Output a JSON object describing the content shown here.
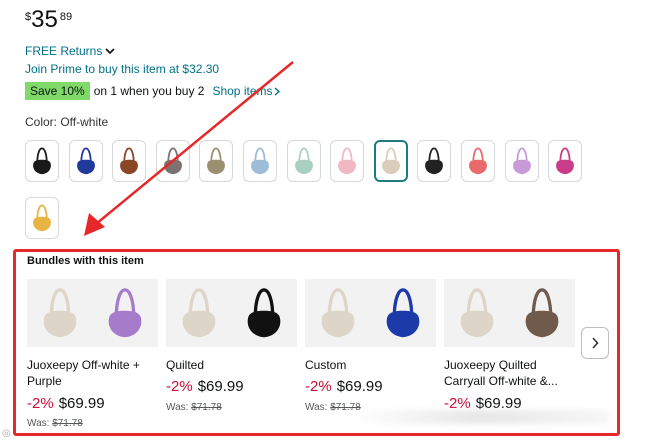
{
  "price": {
    "symbol": "$",
    "whole": "35",
    "fraction": "89"
  },
  "returns": {
    "label": "FREE Returns"
  },
  "prime": {
    "text": "Join Prime to buy this item at $32.30"
  },
  "promo": {
    "badge": "Save 10%",
    "text": "on 1 when you buy 2",
    "link": "Shop items"
  },
  "color": {
    "label": "Color: Off-white"
  },
  "swatches": [
    {
      "name": "Black",
      "color": "#1a1a1a"
    },
    {
      "name": "Blue",
      "color": "#1f3a9c"
    },
    {
      "name": "Brown",
      "color": "#8a4726"
    },
    {
      "name": "Grey",
      "color": "#7b7372"
    },
    {
      "name": "Khaki",
      "color": "#9c9072"
    },
    {
      "name": "Light Blue",
      "color": "#9fbcd6"
    },
    {
      "name": "Mint",
      "color": "#a9d0c1"
    },
    {
      "name": "Pink",
      "color": "#efb8c3"
    },
    {
      "name": "Off-white",
      "color": "#d9cdbb",
      "selected": true
    },
    {
      "name": "Black Quilted",
      "color": "#222222"
    },
    {
      "name": "Coral",
      "color": "#e86a6a"
    },
    {
      "name": "Lilac",
      "color": "#c79ad8"
    },
    {
      "name": "Magenta",
      "color": "#c83c8a"
    },
    {
      "name": "Yellow",
      "color": "#e8b442"
    }
  ],
  "bundles": {
    "title": "Bundles with this item",
    "items": [
      {
        "name_line1": "Juoxeepy Off-white +",
        "name_line2": "Purple",
        "discount": "-2%",
        "price": "$69.99",
        "was_label": "Was:",
        "was_price": "$71.78",
        "second_color": "#a67bc9"
      },
      {
        "name_line1": "Quilted",
        "name_line2": "",
        "discount": "-2%",
        "price": "$69.99",
        "was_label": "Was:",
        "was_price": "$71.78",
        "second_color": "#111111"
      },
      {
        "name_line1": "Custom",
        "name_line2": "",
        "discount": "-2%",
        "price": "$69.99",
        "was_label": "Was:",
        "was_price": "$71.78",
        "second_color": "#1c3aa8"
      },
      {
        "name_line1": "Juoxeepy Quilted",
        "name_line2": "Carryall Off-white &...",
        "discount": "-2%",
        "price": "$69.99",
        "was_label": "",
        "was_price": "",
        "second_color": "#6f5a4c"
      }
    ]
  },
  "colors": {
    "link": "#007185",
    "discount": "#CC0C39",
    "badge": "#7FDA69",
    "highlight": "#E6282B",
    "selected_border": "#1E7C7F",
    "base_bag": "#ddd5c7"
  }
}
